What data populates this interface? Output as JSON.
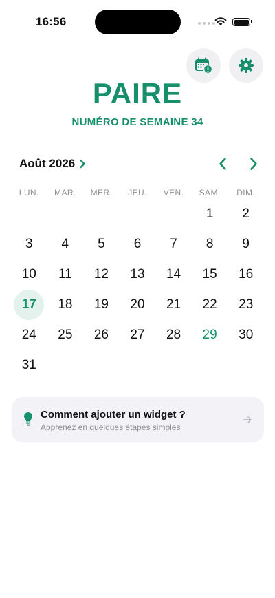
{
  "status_bar": {
    "time": "16:56"
  },
  "header": {
    "parity": "PAIRE",
    "week_label": "NUMÉRO DE SEMAINE 34"
  },
  "calendar": {
    "month_label": "Août 2026",
    "weekdays": [
      "LUN.",
      "MAR.",
      "MER.",
      "JEU.",
      "VEN.",
      "SAM.",
      "DIM."
    ],
    "rows": [
      [
        "",
        "",
        "",
        "",
        "",
        "1",
        "2"
      ],
      [
        "3",
        "4",
        "5",
        "6",
        "7",
        "8",
        "9"
      ],
      [
        "10",
        "11",
        "12",
        "13",
        "14",
        "15",
        "16"
      ],
      [
        "17",
        "18",
        "19",
        "20",
        "21",
        "22",
        "23"
      ],
      [
        "24",
        "25",
        "26",
        "27",
        "28",
        "29",
        "30"
      ],
      [
        "31",
        "",
        "",
        "",
        "",
        "",
        ""
      ]
    ],
    "today": "17",
    "accent_day": "29"
  },
  "widget_card": {
    "title": "Comment ajouter un widget ?",
    "subtitle": "Apprenez en quelques étapes simples"
  },
  "icons": {
    "calendar_button": "calendar-alert-icon",
    "settings_button": "gear-icon",
    "month_chevron": "chevron-right-icon",
    "prev": "chevron-left-icon",
    "next": "chevron-right-icon",
    "widget": "lightbulb-icon",
    "widget_arrow": "arrow-right-icon"
  },
  "colors": {
    "accent": "#168f6b",
    "today_bg": "#e3f2ec",
    "card_bg": "#f2f2f7",
    "muted": "#8e8e93"
  }
}
